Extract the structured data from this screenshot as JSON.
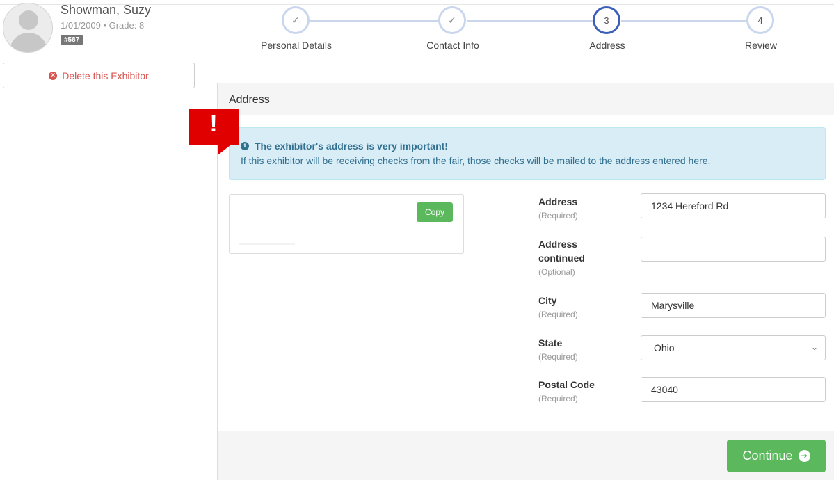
{
  "profile": {
    "name": "Showman, Suzy",
    "subtitle": "1/01/2009 • Grade: 8",
    "badge": "#587",
    "delete_label": "Delete this Exhibitor"
  },
  "stepper": {
    "steps": [
      {
        "symbol": "✓",
        "label": "Personal Details",
        "state": "complete"
      },
      {
        "symbol": "✓",
        "label": "Contact Info",
        "state": "complete"
      },
      {
        "symbol": "3",
        "label": "Address",
        "state": "active"
      },
      {
        "symbol": "4",
        "label": "Review",
        "state": "pending"
      }
    ]
  },
  "panel": {
    "title": "Address",
    "alert": {
      "title": "The exhibitor's address is very important!",
      "text": "If this exhibitor will be receiving checks from the fair, those checks will be mailed to the address entered here."
    },
    "copy_label": "Copy",
    "fields": [
      {
        "label": "Address",
        "note": "(Required)",
        "value": "1234 Hereford Rd"
      },
      {
        "label": "Address continued",
        "note": "(Optional)",
        "value": ""
      },
      {
        "label": "City",
        "note": "(Required)",
        "value": "Marysville"
      },
      {
        "label": "State",
        "note": "(Required)",
        "value": "Ohio"
      },
      {
        "label": "Postal Code",
        "note": "(Required)",
        "value": "43040"
      }
    ],
    "continue_label": "Continue"
  },
  "callout": {
    "symbol": "!"
  },
  "colors": {
    "accent": "#3b5fb8",
    "success": "#5cb85c",
    "danger": "#d9534f",
    "info_bg": "#d9edf7",
    "callout": "#e00000"
  }
}
